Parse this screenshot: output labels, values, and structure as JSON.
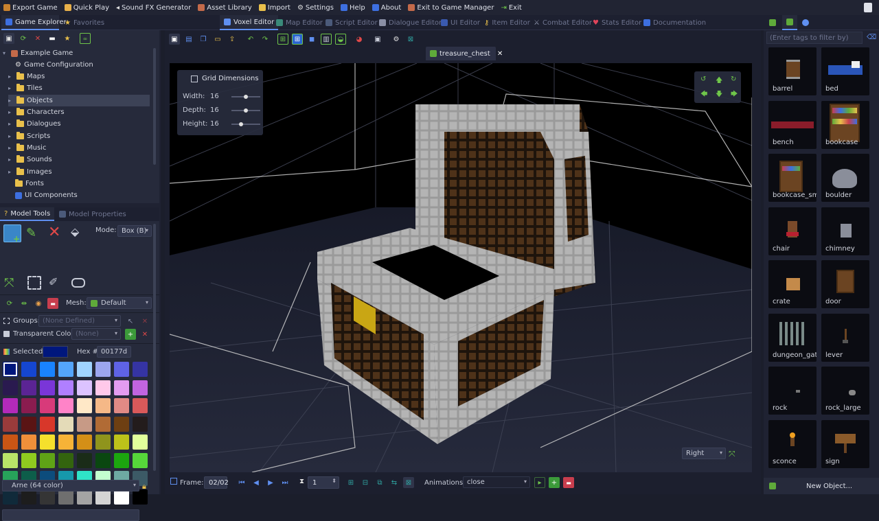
{
  "menubar": {
    "items": [
      {
        "label": "Export Game",
        "icon": "export-icon"
      },
      {
        "label": "Quick Play",
        "icon": "play-icon"
      },
      {
        "label": "Sound FX Generator",
        "icon": "speaker-icon"
      },
      {
        "label": "Asset Library",
        "icon": "library-icon"
      },
      {
        "label": "Import",
        "icon": "import-icon"
      },
      {
        "label": "Settings",
        "icon": "gear-icon"
      },
      {
        "label": "Help",
        "icon": "help-icon"
      },
      {
        "label": "About",
        "icon": "info-icon"
      },
      {
        "label": "Exit to Game Manager",
        "icon": "manager-icon"
      },
      {
        "label": "Exit",
        "icon": "exit-icon"
      }
    ]
  },
  "left_tabs": {
    "explorer": "Game Explorer",
    "favorites": "Favorites"
  },
  "editor_tabs": [
    {
      "label": "Voxel Editor",
      "active": true
    },
    {
      "label": "Map Editor",
      "active": false
    },
    {
      "label": "Script Editor",
      "active": false
    },
    {
      "label": "Dialogue Editor",
      "active": false
    },
    {
      "label": "UI Editor",
      "active": false
    },
    {
      "label": "Item Editor",
      "active": false
    },
    {
      "label": "Combat Editor",
      "active": false
    },
    {
      "label": "Stats Editor",
      "active": false
    },
    {
      "label": "Documentation",
      "active": false
    }
  ],
  "tree": {
    "root": "Example Game",
    "items": [
      {
        "label": "Game Configuration",
        "type": "gear"
      },
      {
        "label": "Maps",
        "type": "folder"
      },
      {
        "label": "Tiles",
        "type": "folder"
      },
      {
        "label": "Objects",
        "type": "folder",
        "selected": true
      },
      {
        "label": "Characters",
        "type": "folder"
      },
      {
        "label": "Dialogues",
        "type": "folder"
      },
      {
        "label": "Scripts",
        "type": "folder"
      },
      {
        "label": "Music",
        "type": "folder"
      },
      {
        "label": "Sounds",
        "type": "folder"
      },
      {
        "label": "Images",
        "type": "folder"
      },
      {
        "label": "Fonts",
        "type": "folder-noarrow"
      },
      {
        "label": "UI Components",
        "type": "component"
      }
    ]
  },
  "model_tabs": {
    "tools": "Model Tools",
    "properties": "Model Properties"
  },
  "model": {
    "mode_label": "Mode:",
    "mode_value": "Box (B)",
    "mesh_label": "Mesh:",
    "mesh_value": "Default",
    "groups_label": "Groups:",
    "groups_value": "(None Defined)",
    "transparent_label": "Transparent Colors:",
    "transparent_value": "(None)",
    "selected_label": "Selected:",
    "hex_label": "Hex #:",
    "hex_value": "00177d",
    "selected_color": "#00177d",
    "palette_name": "Arne (64 color)",
    "palette": [
      "#00177d",
      "#1546d0",
      "#1983ff",
      "#54a5fb",
      "#a0d4ff",
      "#9ca6ef",
      "#5f63e6",
      "#3534a3",
      "#2a1a4f",
      "#5b2494",
      "#7a36d8",
      "#b07fff",
      "#dcc3ff",
      "#ffc9ea",
      "#e39cf0",
      "#c164e0",
      "#b32ab9",
      "#8a1c4f",
      "#d83a7a",
      "#ff83c8",
      "#ffe8c7",
      "#f5b887",
      "#e18a85",
      "#d8595a",
      "#9a3b3b",
      "#5a1414",
      "#d8372a",
      "#e4dbb8",
      "#c79a86",
      "#b16b35",
      "#6e3f12",
      "#231c1c",
      "#c95515",
      "#f08f3a",
      "#f5e02c",
      "#f6b337",
      "#d48f17",
      "#8f941c",
      "#bdc21a",
      "#e1ff9b",
      "#b8e468",
      "#8fcb1f",
      "#5fa316",
      "#33640e",
      "#1a2c18",
      "#0a4710",
      "#1ca60f",
      "#56d63a",
      "#27a35a",
      "#0d5e4a",
      "#0c4c7c",
      "#1698ab",
      "#2fe3c7",
      "#c3ffcf",
      "#6ea9a3",
      "#3c5a66",
      "#102a3a",
      "#1d1d1d",
      "#353535",
      "#6f6f6f",
      "#a4a4a4",
      "#d4d4d4",
      "#ffffff",
      "#000000"
    ]
  },
  "viewport": {
    "tab_label": "treasure_chest",
    "grid_title": "Grid Dimensions",
    "grid": [
      {
        "label": "Width:",
        "value": "16",
        "level": 0.5
      },
      {
        "label": "Depth:",
        "value": "16",
        "level": 0.5
      },
      {
        "label": "Height:",
        "value": "16",
        "level": 0.3
      }
    ],
    "view_select": "Right"
  },
  "bottombar": {
    "frame_label": "Frame:",
    "frame_value": "02/02",
    "spin_value": "1",
    "animations_label": "Animations:",
    "animation_value": "close"
  },
  "right": {
    "filter_placeholder": "(Enter tags to filter by)",
    "assets": [
      {
        "name": "barrel"
      },
      {
        "name": "bed"
      },
      {
        "name": "bench"
      },
      {
        "name": "bookcase"
      },
      {
        "name": "bookcase_sm."
      },
      {
        "name": "boulder"
      },
      {
        "name": "chair"
      },
      {
        "name": "chimney"
      },
      {
        "name": "crate"
      },
      {
        "name": "door"
      },
      {
        "name": "dungeon_gate"
      },
      {
        "name": "lever"
      },
      {
        "name": "rock"
      },
      {
        "name": "rock_large"
      },
      {
        "name": "sconce"
      },
      {
        "name": "sign"
      }
    ],
    "new_object_label": "New Object..."
  }
}
